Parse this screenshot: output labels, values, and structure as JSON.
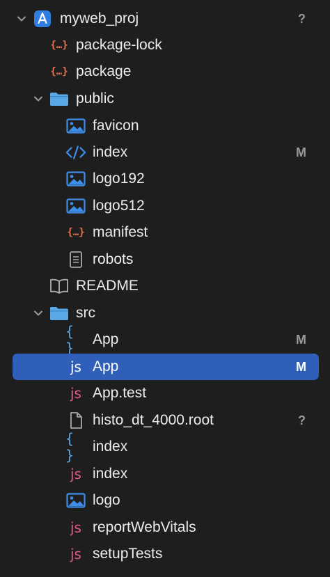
{
  "project": {
    "name": "myweb_proj",
    "badge": "?"
  },
  "items": {
    "package_lock": {
      "label": "package-lock",
      "icon": "json-file-icon"
    },
    "package": {
      "label": "package",
      "icon": "json-file-icon"
    },
    "public": {
      "label": "public",
      "icon": "folder-icon"
    },
    "favicon": {
      "label": "favicon",
      "icon": "image-file-icon"
    },
    "index_html": {
      "label": "index",
      "icon": "code-file-icon",
      "badge": "M"
    },
    "logo192": {
      "label": "logo192",
      "icon": "image-file-icon"
    },
    "logo512": {
      "label": "logo512",
      "icon": "image-file-icon"
    },
    "manifest": {
      "label": "manifest",
      "icon": "json-file-icon"
    },
    "robots": {
      "label": "robots",
      "icon": "text-file-icon"
    },
    "readme": {
      "label": "README",
      "icon": "book-icon"
    },
    "src": {
      "label": "src",
      "icon": "folder-icon"
    },
    "app_css": {
      "label": "App",
      "icon": "css-file-icon",
      "badge": "M"
    },
    "app_js": {
      "label": "App",
      "icon": "js-file-icon",
      "badge": "M"
    },
    "app_test": {
      "label": "App.test",
      "icon": "js-file-icon"
    },
    "histo": {
      "label": "histo_dt_4000.root",
      "icon": "blank-file-icon",
      "badge": "?"
    },
    "index_css": {
      "label": "index",
      "icon": "css-file-icon"
    },
    "index_js": {
      "label": "index",
      "icon": "js-file-icon"
    },
    "logo": {
      "label": "logo",
      "icon": "image-file-icon"
    },
    "report": {
      "label": "reportWebVitals",
      "icon": "js-file-icon"
    },
    "setup": {
      "label": "setupTests",
      "icon": "js-file-icon"
    }
  },
  "glyphs": {
    "js": "js",
    "json": "{…}",
    "css": "{ }",
    "code": "</>"
  },
  "colors": {
    "selection": "#2f5fb8",
    "folder": "#5aa9e6",
    "js": "#e05a86",
    "json": "#e8704a",
    "css": "#5ba8e0",
    "image": "#3d8ee8"
  }
}
